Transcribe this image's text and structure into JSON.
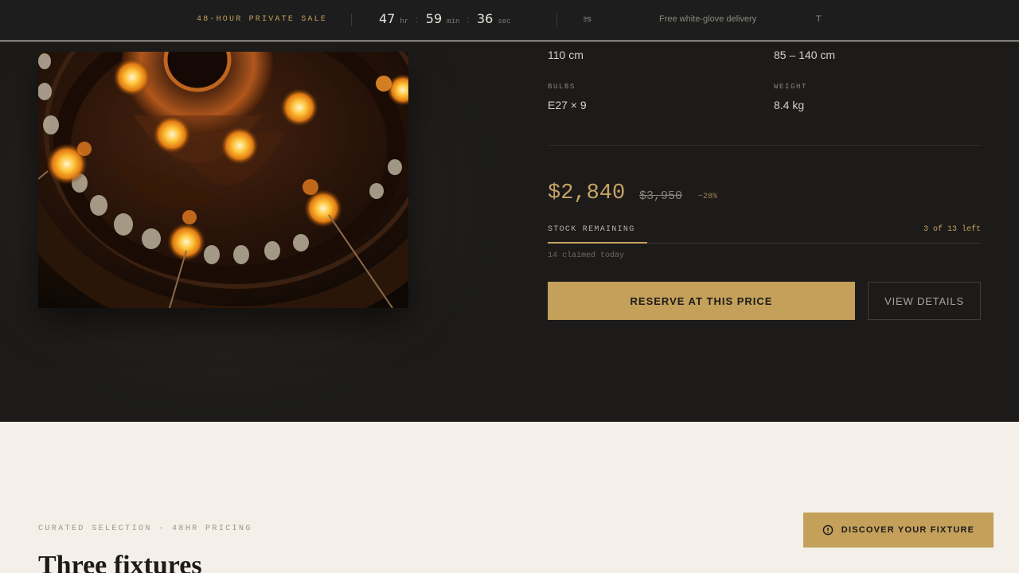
{
  "topbar": {
    "sale_label": "48-HOUR PRIVATE SALE",
    "countdown": {
      "hours": "47",
      "hours_unit": "hr",
      "minutes": "59",
      "minutes_unit": "min",
      "seconds": "36",
      "seconds_unit": "sec",
      "separator": ":"
    },
    "ticker": [
      "pieces",
      "Free white-glove delivery",
      "T"
    ]
  },
  "hero": {
    "image_icon": "chandelier-photo",
    "specs": [
      {
        "label": "",
        "value": "110 cm"
      },
      {
        "label": "",
        "value": "85 – 140 cm"
      },
      {
        "label": "BULBS",
        "value": "E27 × 9"
      },
      {
        "label": "WEIGHT",
        "value": "8.4 kg"
      }
    ],
    "price": "$2,840",
    "price_old": "$3,950",
    "discount": "−28%",
    "stock": {
      "label": "STOCK REMAINING",
      "count_text": "3 of 13 left",
      "fill_fraction": 0.23,
      "claimed_text": "14 claimed today"
    },
    "reserve_label": "RESERVE AT THIS PRICE",
    "details_label": "VIEW DETAILS"
  },
  "curated": {
    "eyebrow": "CURATED SELECTION · 48HR PRICING",
    "title": "Three fixtures",
    "discover_label": "DISCOVER YOUR FIXTURE",
    "discover_icon": "info-circle-icon"
  },
  "colors": {
    "accent": "#c4a05a",
    "dark_bg": "#1c1b1a",
    "light_bg": "#f4efe8"
  }
}
